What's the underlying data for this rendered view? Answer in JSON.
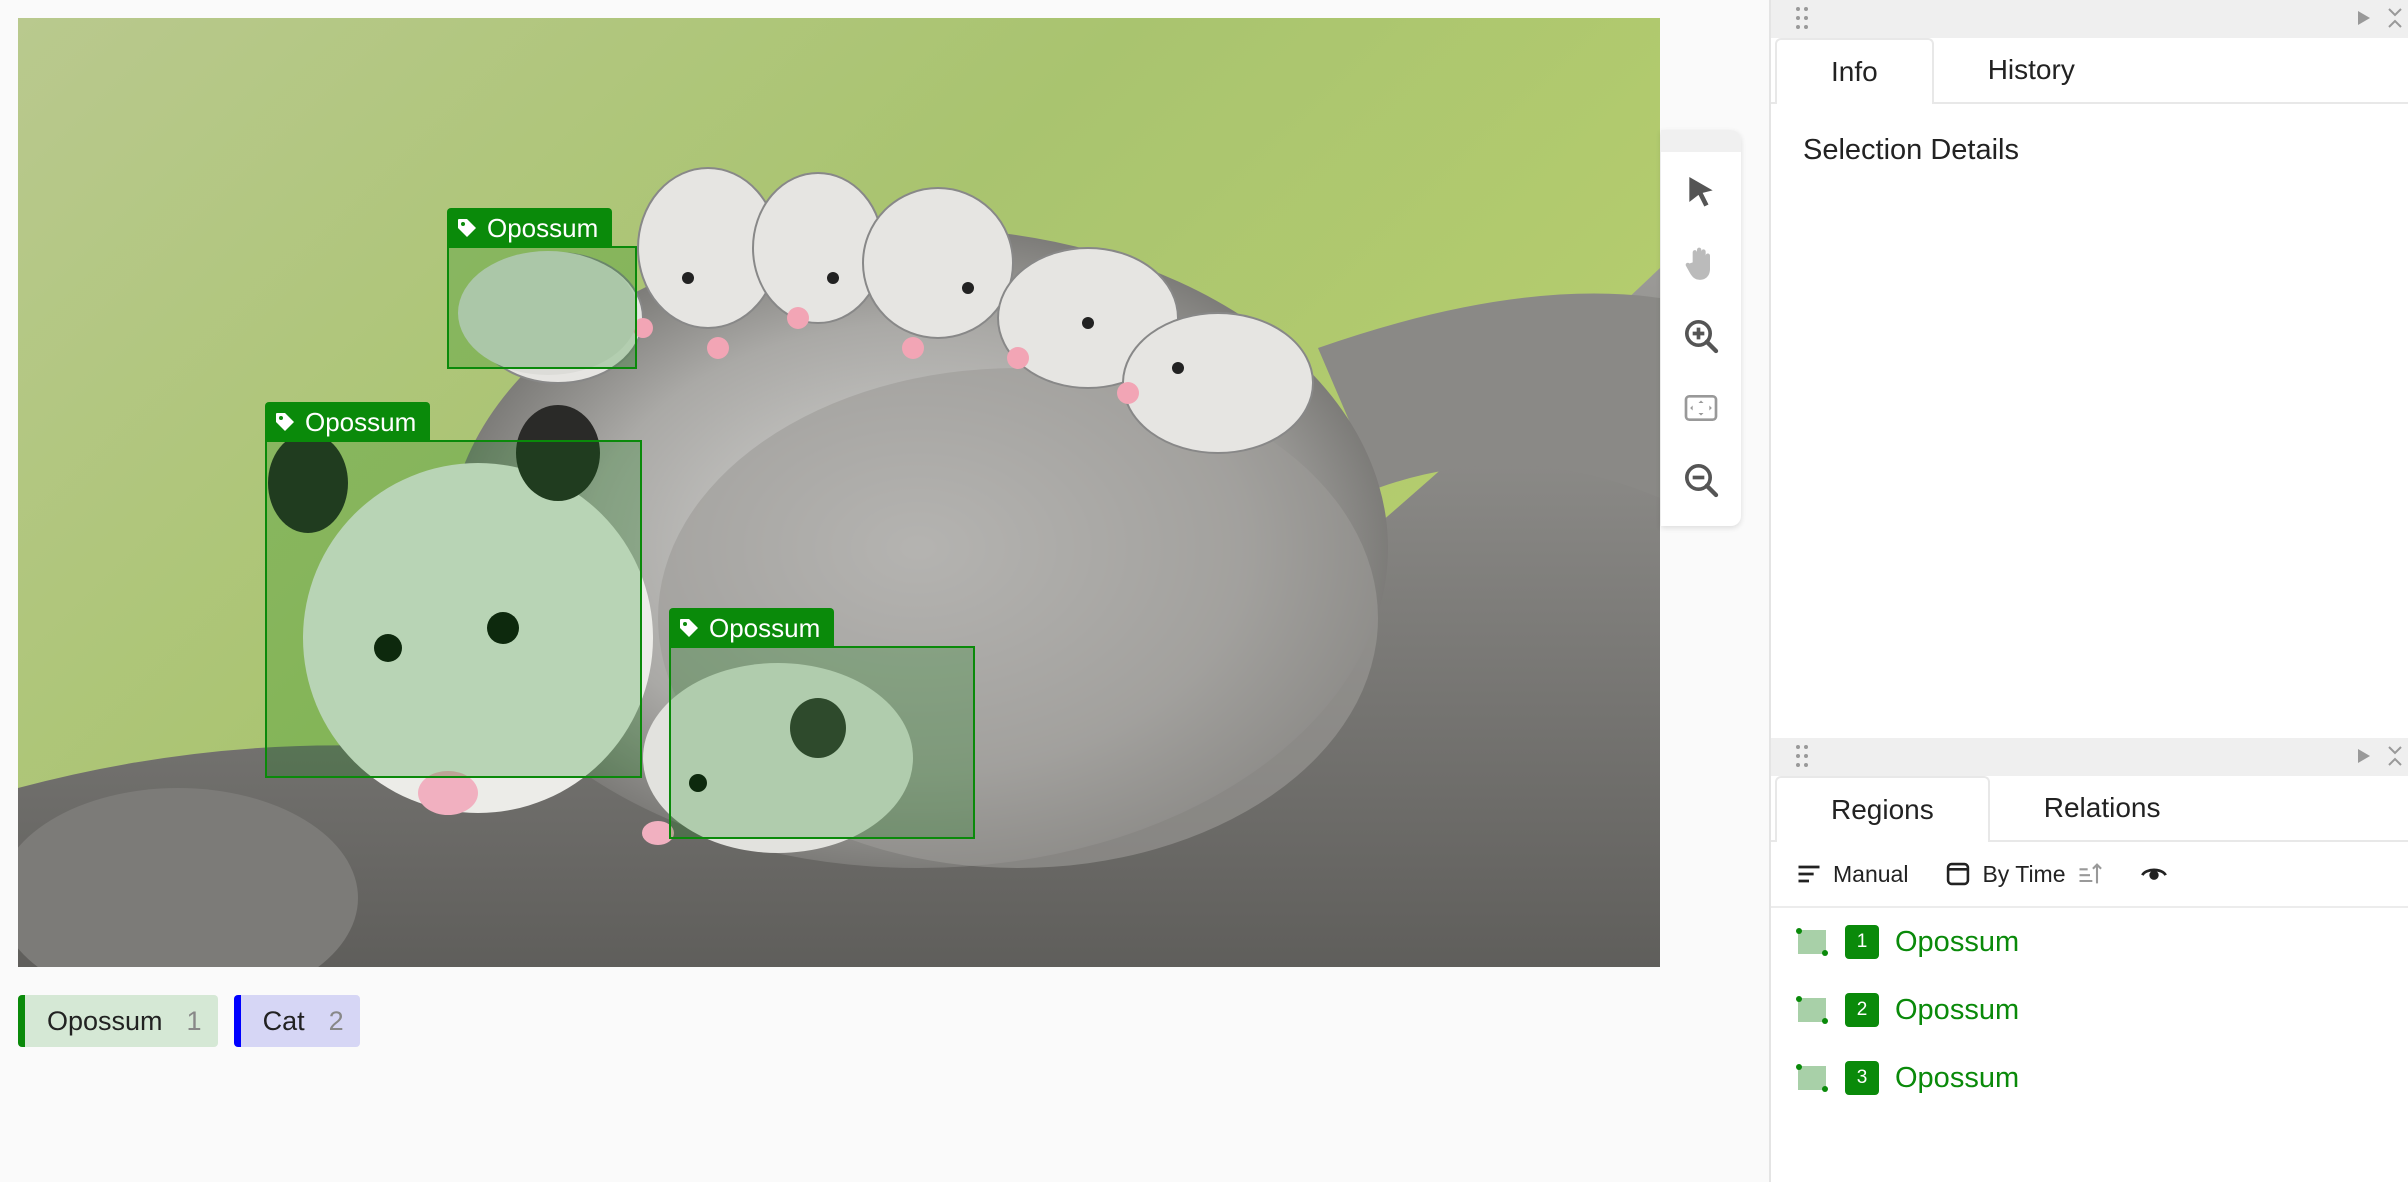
{
  "canvas": {
    "regions": [
      {
        "label": "Opossum",
        "color": "#0a8a0a"
      },
      {
        "label": "Opossum",
        "color": "#0a8a0a"
      },
      {
        "label": "Opossum",
        "color": "#0a8a0a"
      }
    ]
  },
  "toolbar": {
    "tools": [
      "pointer-icon",
      "hand-pan-icon",
      "zoom-in-icon",
      "zoom-fit-icon",
      "zoom-out-icon"
    ]
  },
  "labels": [
    {
      "name": "Opossum",
      "hotkey": "1",
      "color": "#0a8a0a"
    },
    {
      "name": "Cat",
      "hotkey": "2",
      "color": "#0000ff"
    }
  ],
  "info_panel": {
    "tabs": [
      "Info",
      "History"
    ],
    "active_tab": "Info",
    "title": "Selection Details"
  },
  "regions_panel": {
    "tabs": [
      "Regions",
      "Relations"
    ],
    "active_tab": "Regions",
    "sort_manual": "Manual",
    "sort_time": "By Time",
    "rows": [
      {
        "index": "1",
        "label": "Opossum"
      },
      {
        "index": "2",
        "label": "Opossum"
      },
      {
        "index": "3",
        "label": "Opossum"
      }
    ]
  }
}
